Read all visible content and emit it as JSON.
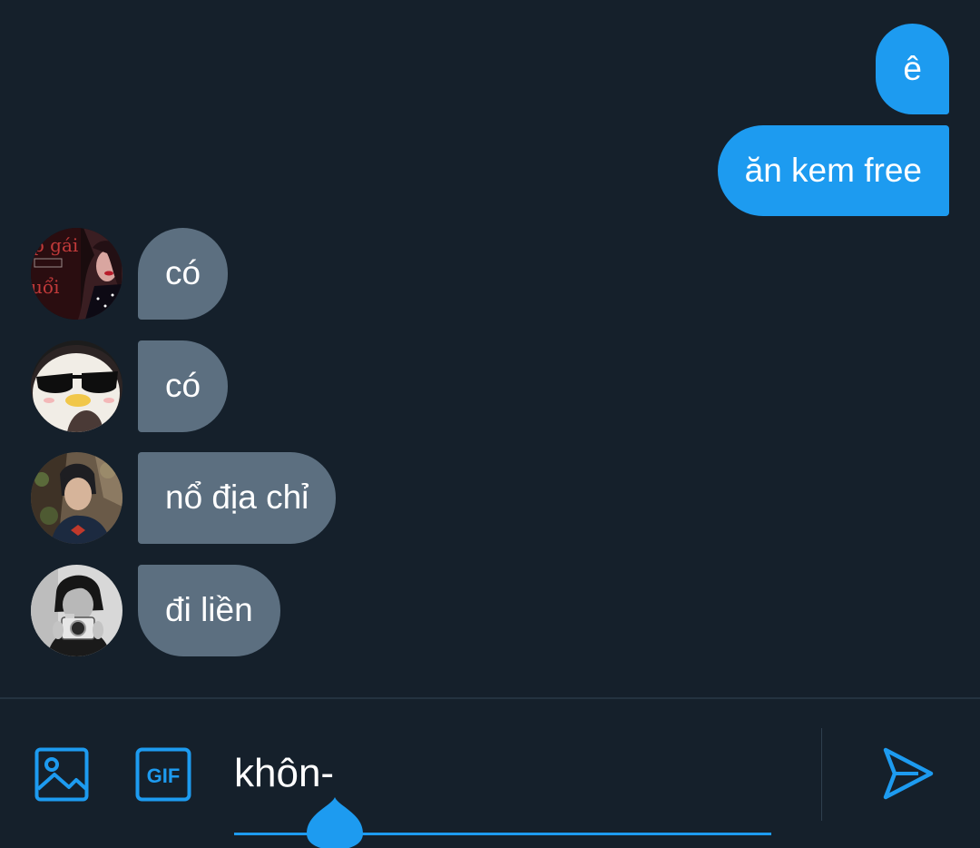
{
  "colors": {
    "background": "#15202b",
    "outgoing_bubble": "#1d9bf0",
    "incoming_bubble": "#5c6f80",
    "accent": "#1d9bf0",
    "text": "#ffffff"
  },
  "messages": {
    "outgoing": [
      {
        "text": "ê"
      },
      {
        "text": "ăn kem free"
      }
    ],
    "incoming": [
      {
        "text": "có",
        "avatar": "avatar-red-poster"
      },
      {
        "text": "có",
        "avatar": "avatar-penguin-sunglasses"
      },
      {
        "text": "nổ địa chỉ",
        "avatar": "avatar-person-photo"
      },
      {
        "text": "đi liền",
        "avatar": "avatar-person-camera"
      }
    ]
  },
  "composer": {
    "input_value": "khôn-",
    "image_icon": "image-icon",
    "gif_icon": "gif-icon",
    "gif_label": "GIF",
    "send_icon": "send-icon"
  }
}
